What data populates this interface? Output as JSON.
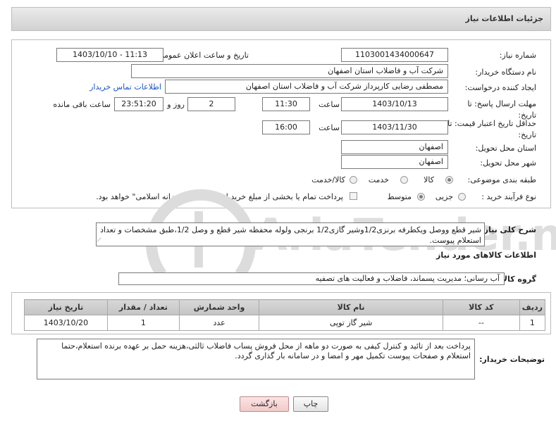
{
  "header": {
    "title": "جزئیات اطلاعات نیاز"
  },
  "form": {
    "need_number_label": "شماره نیاز:",
    "need_number": "1103001434000647",
    "announce_label": "تاریخ و ساعت اعلان عمومی:",
    "announce_value": "1403/10/10 - 11:13",
    "buyer_org_label": "نام دستگاه خریدار:",
    "buyer_org": "شرکت آب و فاضلاب استان اصفهان",
    "creator_label": "ایجاد کننده درخواست:",
    "creator": "مصطفی رضایی کارپرداز شرکت آب و فاضلاب استان اصفهان",
    "contact_link": "اطلاعات تماس خریدار",
    "reply_deadline_label": "مهلت ارسال پاسخ: تا تاریخ:",
    "reply_date": "1403/10/13",
    "time_label": "ساعت",
    "reply_time": "11:30",
    "days_value": "2",
    "days_label": "روز و",
    "remaining_time": "23:51:20",
    "remaining_label": "ساعت باقی مانده",
    "price_validity_label": "حداقل تاریخ اعتبار قیمت: تا تاریخ:",
    "validity_date": "1403/11/30",
    "validity_time": "16:00",
    "province_label": "استان محل تحویل:",
    "province": "اصفهان",
    "city_label": "شهر محل تحویل:",
    "city": "اصفهان",
    "category_label": "طبقه بندی موضوعی:",
    "category_options": [
      "کالا",
      "خدمت",
      "کالا/خدمت"
    ],
    "purchase_type_label": "نوع فرآیند خرید :",
    "purchase_options": [
      "جزیی",
      "متوسط"
    ],
    "treasury_note": "پرداخت تمام یا بخشی از مبلغ خرید،از محل \"اسناد خزانه اسلامی\" خواهد بود."
  },
  "description": {
    "label": "شرح کلی نیاز:",
    "text": "شیر قطع ووصل ویکطرفه برنزی1/2وشیر گازی1/2 برنجی ولوله محفظه شیر قطع و وصل 1/2،طبق مشخصات و تعداد استعلام پیوست."
  },
  "items_section": {
    "title": "اطلاعات کالاهای مورد نیاز",
    "group_label": "گروه کالا:",
    "group_value": "آب رسانی؛ مدیریت پسماند، فاضلاب و فعالیت های تصفیه",
    "columns": [
      "ردیف",
      "کد کالا",
      "نام کالا",
      "واحد شمارش",
      "تعداد / مقدار",
      "تاریخ نیاز"
    ],
    "rows": [
      {
        "row": "1",
        "code": "--",
        "name": "شیر گاز توپی",
        "unit": "عدد",
        "qty": "1",
        "date": "1403/10/20"
      }
    ]
  },
  "buyer_notes": {
    "label": "توضیحات خریدار:",
    "text": "پرداخت بعد از تائید و کنترل کیفی به صورت دو ماهه از محل فروش پساب فاضلاب ثالثی،هزینه حمل بر عهده برنده استعلام،حتما استعلام و صفحات پیوست تکمیل مهر و امضا و در سامانه بار گذاری گردد."
  },
  "buttons": {
    "print": "چاپ",
    "back": "بازگشت"
  },
  "watermark": {
    "text": "AriaTender.neT"
  },
  "colors": {
    "link": "#1a55c8",
    "back_button": "#f1caca",
    "watermark": "#d8d8d8"
  }
}
